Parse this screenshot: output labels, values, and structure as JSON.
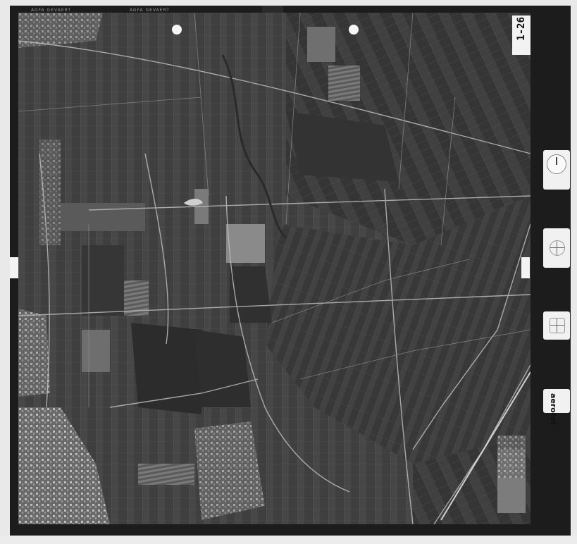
{
  "film": {
    "top_strip": [
      "AGFA GEVAERT",
      "AGFA GEVAERT"
    ],
    "corner_id": "",
    "frame_label": "1-26"
  },
  "instruments": {
    "altimeter": {
      "icon": "altimeter-dial-icon"
    },
    "compass": {
      "icon": "compass-icon"
    },
    "level": {
      "icon": "level-bubble-icon"
    },
    "brand_label": "aerofot"
  },
  "colors": {
    "film_border": "#1c1c1c",
    "photo_base": "#4a4a4a",
    "paper": "#e9e9e9"
  }
}
